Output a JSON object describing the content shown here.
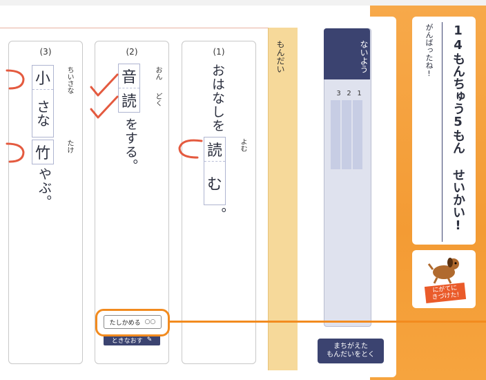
{
  "questions": [
    {
      "number": "(1)",
      "text_before": "おはなしを",
      "furigana": "よむ",
      "kanji": "読",
      "answer_kana": "む",
      "text_after": "。"
    },
    {
      "number": "(2)",
      "furigana_1": "おん",
      "furigana_2": "どく",
      "kanji_1": "音",
      "kanji_2": "読",
      "text_after": "をする。"
    },
    {
      "number": "(3)",
      "furigana_1": "ちいさな",
      "kanji_1": "小",
      "answer_kana_1": "さな",
      "furigana_2": "たけ",
      "kanji_2": "竹",
      "text_after": "やぶ。"
    }
  ],
  "side_tab": {
    "label": "もんだい"
  },
  "contents": {
    "title": "ないよう",
    "items": [
      "1",
      "2",
      "3"
    ]
  },
  "buttons": {
    "check": "たしかめる",
    "check_icon": "pen-icon",
    "solve": "ときなおす",
    "retry_line1": "まちがえた",
    "retry_line2": "もんだいをとく"
  },
  "score": {
    "main": "14もんちゅう5もん せいかい!",
    "sub": "がんばったね!"
  },
  "badge": {
    "line1": "にがてに",
    "line2": "きづけた!"
  },
  "colors": {
    "accent": "#f28b1f",
    "navy": "#3b4370",
    "mark_red": "#e45a3f",
    "tab_yellow": "#f6d99a"
  }
}
